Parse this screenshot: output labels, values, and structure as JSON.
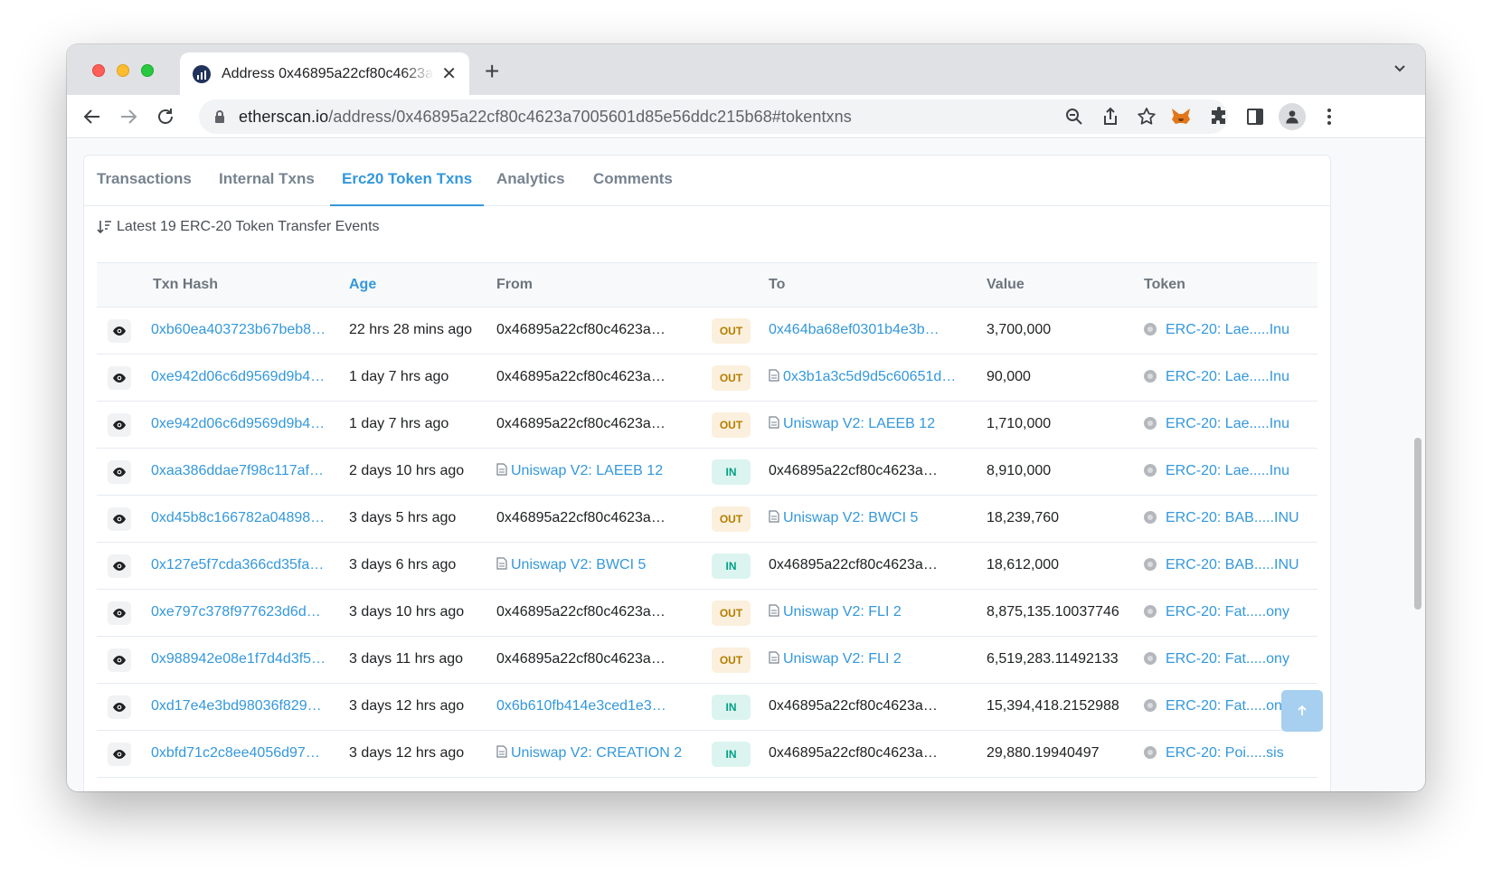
{
  "browser": {
    "tab_title": "Address 0x46895a22cf80c4623a7005601d85e56ddc215b68",
    "url_host": "etherscan.io",
    "url_path": "/address/0x46895a22cf80c4623a7005601d85e56ddc215b68#tokentxns"
  },
  "tabs": [
    {
      "label": "Transactions"
    },
    {
      "label": "Internal Txns"
    },
    {
      "label": "Erc20 Token Txns"
    },
    {
      "label": "Analytics"
    },
    {
      "label": "Comments"
    }
  ],
  "active_tab": "Erc20 Token Txns",
  "summary": "Latest 19 ERC-20 Token Transfer Events",
  "columns": {
    "hash": "Txn Hash",
    "age": "Age",
    "from": "From",
    "to": "To",
    "value": "Value",
    "token": "Token"
  },
  "rows": [
    {
      "hash": "0xb60ea403723b67beb8…",
      "age": "22 hrs 28 mins ago",
      "from": "0x46895a22cf80c4623a…",
      "from_link": false,
      "from_contract": false,
      "direction": "OUT",
      "to": "0x464ba68ef0301b4e3b…",
      "to_link": true,
      "to_contract": false,
      "value": "3,700,000",
      "token": "ERC-20: Lae.....Inu"
    },
    {
      "hash": "0xe942d06c6d9569d9b4…",
      "age": "1 day 7 hrs ago",
      "from": "0x46895a22cf80c4623a…",
      "from_link": false,
      "from_contract": false,
      "direction": "OUT",
      "to": "0x3b1a3c5d9d5c60651d…",
      "to_link": true,
      "to_contract": true,
      "value": "90,000",
      "token": "ERC-20: Lae.....Inu"
    },
    {
      "hash": "0xe942d06c6d9569d9b4…",
      "age": "1 day 7 hrs ago",
      "from": "0x46895a22cf80c4623a…",
      "from_link": false,
      "from_contract": false,
      "direction": "OUT",
      "to": "Uniswap V2: LAEEB 12",
      "to_link": true,
      "to_contract": true,
      "value": "1,710,000",
      "token": "ERC-20: Lae.....Inu"
    },
    {
      "hash": "0xaa386ddae7f98c117af…",
      "age": "2 days 10 hrs ago",
      "from": "Uniswap V2: LAEEB 12",
      "from_link": true,
      "from_contract": true,
      "direction": "IN",
      "to": "0x46895a22cf80c4623a…",
      "to_link": false,
      "to_contract": false,
      "value": "8,910,000",
      "token": "ERC-20: Lae.....Inu"
    },
    {
      "hash": "0xd45b8c166782a04898…",
      "age": "3 days 5 hrs ago",
      "from": "0x46895a22cf80c4623a…",
      "from_link": false,
      "from_contract": false,
      "direction": "OUT",
      "to": "Uniswap V2: BWCI 5",
      "to_link": true,
      "to_contract": true,
      "value": "18,239,760",
      "token": "ERC-20: BAB.....INU"
    },
    {
      "hash": "0x127e5f7cda366cd35fa…",
      "age": "3 days 6 hrs ago",
      "from": "Uniswap V2: BWCI 5",
      "from_link": true,
      "from_contract": true,
      "direction": "IN",
      "to": "0x46895a22cf80c4623a…",
      "to_link": false,
      "to_contract": false,
      "value": "18,612,000",
      "token": "ERC-20: BAB.....INU"
    },
    {
      "hash": "0xe797c378f977623d6d…",
      "age": "3 days 10 hrs ago",
      "from": "0x46895a22cf80c4623a…",
      "from_link": false,
      "from_contract": false,
      "direction": "OUT",
      "to": "Uniswap V2: FLI 2",
      "to_link": true,
      "to_contract": true,
      "value": "8,875,135.10037746",
      "token": "ERC-20: Fat.....ony"
    },
    {
      "hash": "0x988942e08e1f7d4d3f5…",
      "age": "3 days 11 hrs ago",
      "from": "0x46895a22cf80c4623a…",
      "from_link": false,
      "from_contract": false,
      "direction": "OUT",
      "to": "Uniswap V2: FLI 2",
      "to_link": true,
      "to_contract": true,
      "value": "6,519,283.11492133",
      "token": "ERC-20: Fat.....ony"
    },
    {
      "hash": "0xd17e4e3bd98036f829…",
      "age": "3 days 12 hrs ago",
      "from": "0x6b610fb414e3ced1e3…",
      "from_link": true,
      "from_contract": false,
      "direction": "IN",
      "to": "0x46895a22cf80c4623a…",
      "to_link": false,
      "to_contract": false,
      "value": "15,394,418.2152988",
      "token": "ERC-20: Fat.....ony"
    },
    {
      "hash": "0xbfd71c2c8ee4056d97…",
      "age": "3 days 12 hrs ago",
      "from": "Uniswap V2: CREATION 2",
      "from_link": true,
      "from_contract": true,
      "direction": "IN",
      "to": "0x46895a22cf80c4623a…",
      "to_link": false,
      "to_contract": false,
      "value": "29,880.19940497",
      "token": "ERC-20: Poi.....sis"
    }
  ]
}
